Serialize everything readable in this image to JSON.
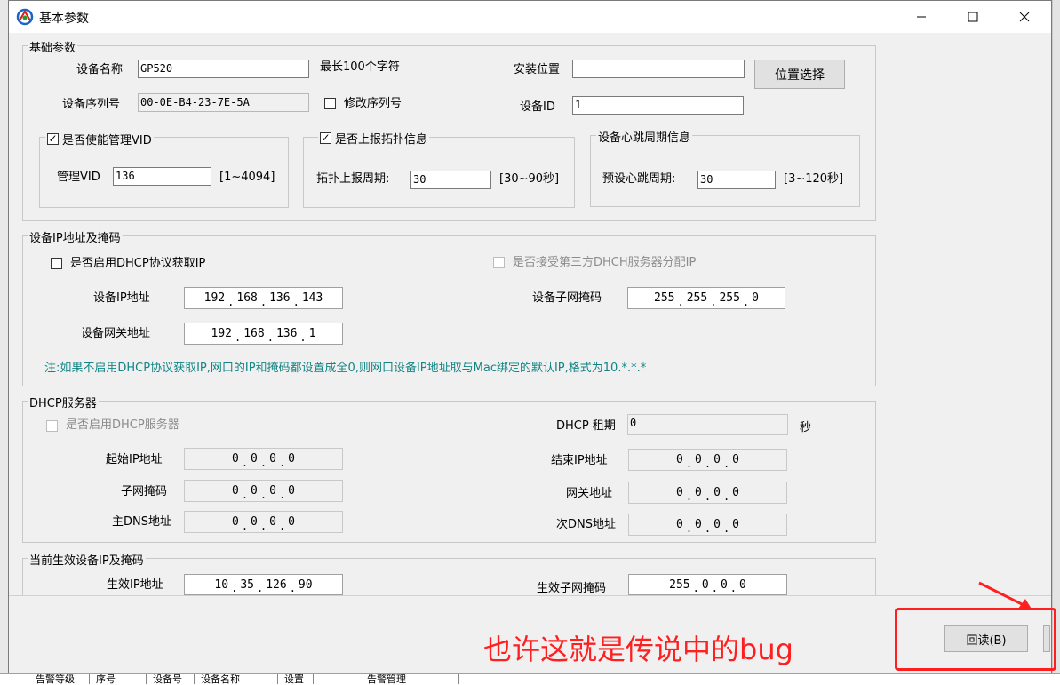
{
  "window": {
    "title": "基本参数"
  },
  "basic": {
    "legend": "基础参数",
    "device_name_label": "设备名称",
    "device_name": "GP520",
    "max_len_hint": "最长100个字符",
    "location_label": "安装位置",
    "location_value": "",
    "location_button": "位置选择",
    "serial_label": "设备序列号",
    "serial": "00-0E-B4-23-7E-5A",
    "modify_serial_label": "修改序列号",
    "device_id_label": "设备ID",
    "device_id": "1",
    "vid_legend": "是否使能管理VID",
    "vid_label": "管理VID",
    "vid_value": "136",
    "vid_range": "[1~4094]",
    "topo_legend": "是否上报拓扑信息",
    "topo_label": "拓扑上报周期:",
    "topo_value": "30",
    "topo_range": "[30~90秒]",
    "hb_legend": "设备心跳周期信息",
    "hb_label": "预设心跳周期:",
    "hb_value": "30",
    "hb_range": "[3~120秒]"
  },
  "ip": {
    "legend": "设备IP地址及掩码",
    "dhcp_client_label": "是否启用DHCP协议获取IP",
    "third_party_label": "是否接受第三方DHCH服务器分配IP",
    "ip_label": "设备IP地址",
    "ip": [
      "192",
      "168",
      "136",
      "143"
    ],
    "mask_label": "设备子网掩码",
    "mask": [
      "255",
      "255",
      "255",
      "0"
    ],
    "gw_label": "设备网关地址",
    "gw": [
      "192",
      "168",
      "136",
      "1"
    ],
    "note": "注:如果不启用DHCP协议获取IP,网口的IP和掩码都设置成全0,则网口设备IP地址取与Mac绑定的默认IP,格式为10.*.*.*"
  },
  "dhcp": {
    "legend": "DHCP服务器",
    "enable_label": "是否启用DHCP服务器",
    "lease_label": "DHCP 租期",
    "lease_value": "0",
    "lease_unit": "秒",
    "start_label": "起始IP地址",
    "start": [
      "0",
      "0",
      "0",
      "0"
    ],
    "end_label": "结束IP地址",
    "end": [
      "0",
      "0",
      "0",
      "0"
    ],
    "mask_label": "子网掩码",
    "mask": [
      "0",
      "0",
      "0",
      "0"
    ],
    "gw_label": "网关地址",
    "gw": [
      "0",
      "0",
      "0",
      "0"
    ],
    "dns1_label": "主DNS地址",
    "dns1": [
      "0",
      "0",
      "0",
      "0"
    ],
    "dns2_label": "次DNS地址",
    "dns2": [
      "0",
      "0",
      "0",
      "0"
    ]
  },
  "current": {
    "legend": "当前生效设备IP及掩码",
    "ip_label": "生效IP地址",
    "ip": [
      "10",
      "35",
      "126",
      "90"
    ],
    "mask_label": "生效子网掩码",
    "mask": [
      "255",
      "0",
      "0",
      "0"
    ]
  },
  "footer": {
    "readback_button": "回读(B)"
  },
  "annotation": {
    "text": "也许这就是传说中的bug",
    "color": "#ff1f1f"
  },
  "background_tabs": [
    "告警等级",
    "序号",
    "设备号",
    "设备名称",
    "设置",
    "告警管理"
  ]
}
